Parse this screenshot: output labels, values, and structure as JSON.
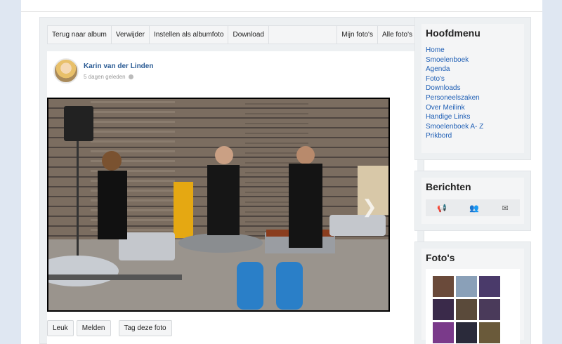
{
  "toolbar": {
    "back": "Terug naar album",
    "delete": "Verwijder",
    "set_album_photo": "Instellen als albumfoto",
    "download": "Download",
    "my_photos": "Mijn foto's",
    "all_photos": "Alle foto's"
  },
  "post": {
    "author": "Karin van der Linden",
    "time": "5 dagen geleden",
    "photo_alt": "Foto van koks die buiten barbecuen"
  },
  "actions": {
    "like": "Leuk",
    "report": "Melden",
    "tag": "Tag deze foto"
  },
  "sidebar": {
    "main_menu": {
      "title": "Hoofdmenu",
      "items": [
        "Home",
        "Smoelenboek",
        "Agenda",
        "Foto's",
        "Downloads",
        "Personeelszaken",
        "Over Meilink",
        "Handige Links",
        "Smoelenboek A- Z",
        "Prikbord"
      ]
    },
    "messages": {
      "title": "Berichten",
      "icons": [
        "megaphone-icon",
        "users-icon",
        "envelope-icon"
      ]
    },
    "photos": {
      "title": "Foto's"
    }
  },
  "colors": {
    "link": "#1f5fb5",
    "author": "#2a5b94",
    "background": "#dfe7f2"
  }
}
